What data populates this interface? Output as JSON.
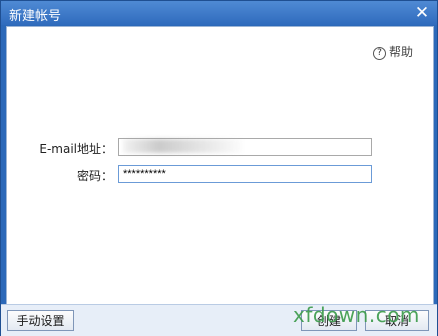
{
  "window": {
    "title": "新建帐号",
    "close_glyph": "✕"
  },
  "help": {
    "icon_glyph": "?",
    "label": "帮助"
  },
  "form": {
    "email_label": "E-mail地址：",
    "email_value": "",
    "password_label": "密码：",
    "password_value": "**********"
  },
  "footer": {
    "manual_setup_label": "手动设置",
    "create_label": "创建",
    "cancel_label": "取消"
  },
  "watermark": "xfdown.com",
  "colors": {
    "title_bar": "#2f6bbd",
    "footer": "#e7eef8",
    "watermark": "#3e9c4d"
  }
}
